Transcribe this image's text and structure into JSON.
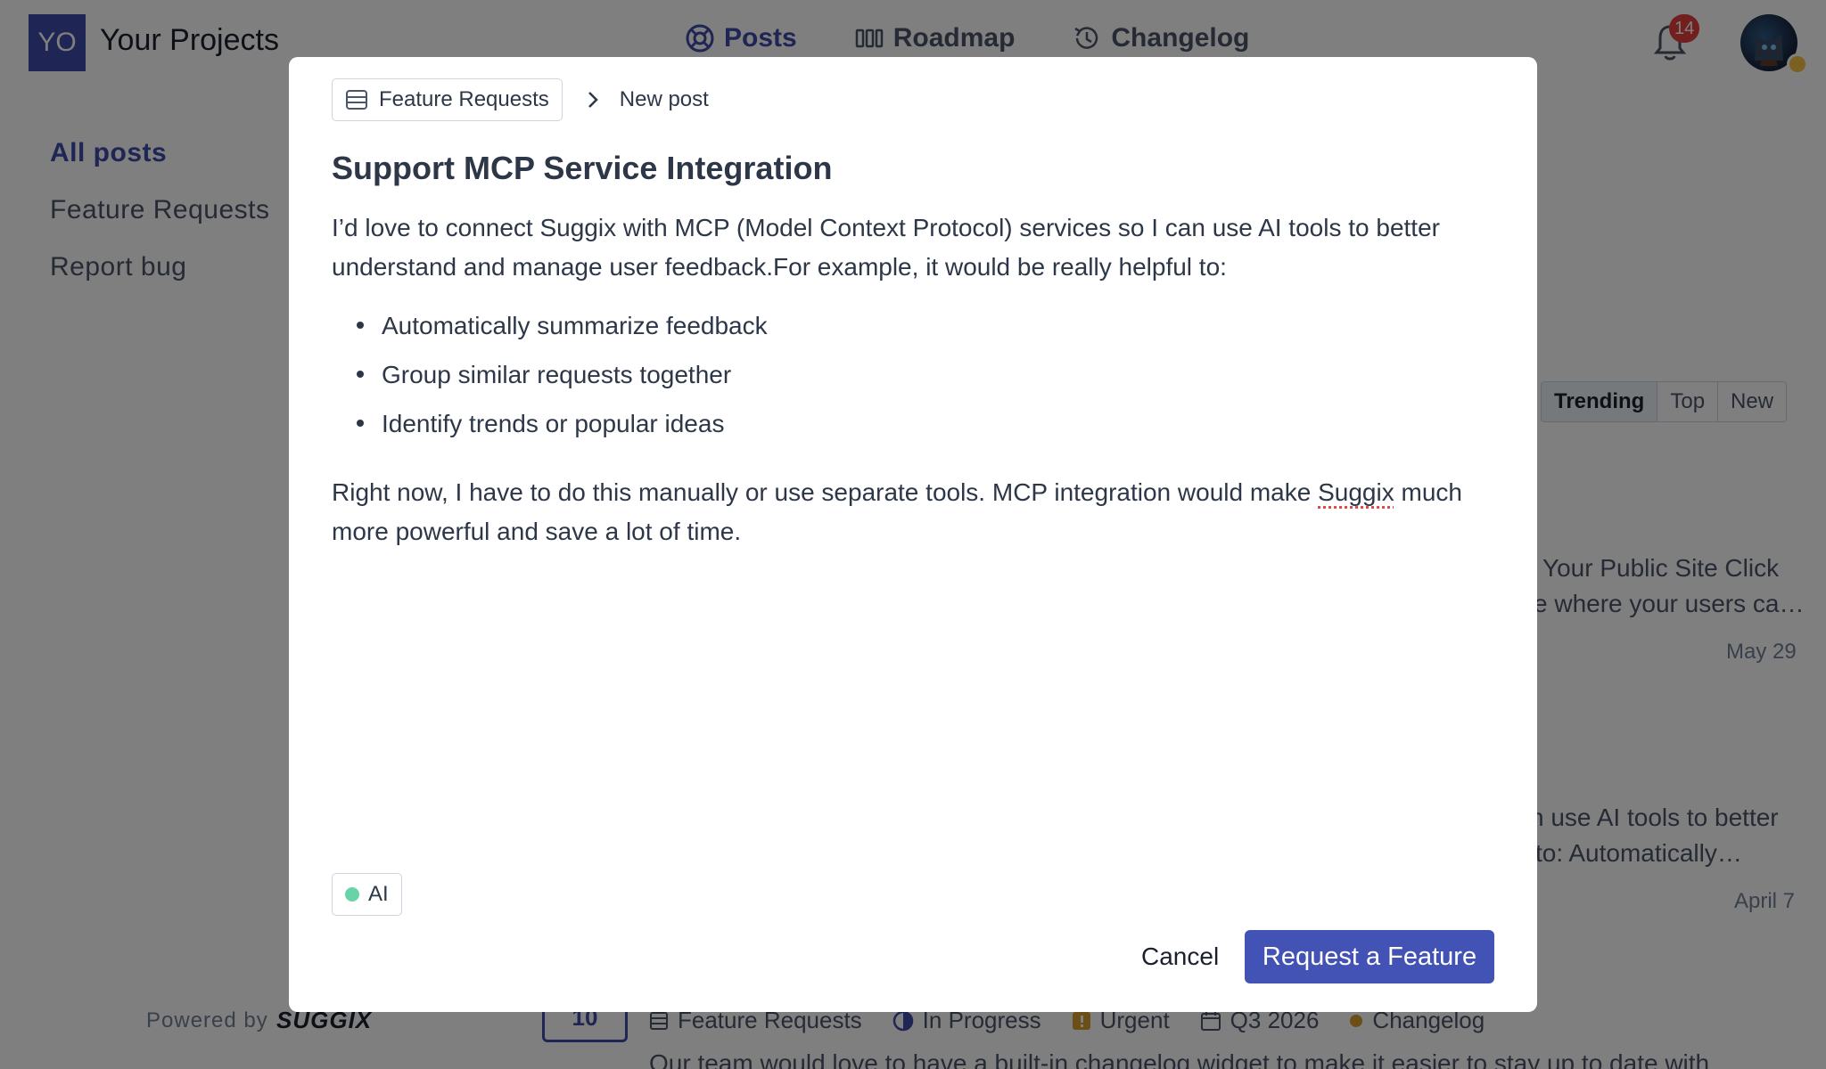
{
  "app": {
    "logo_initials": "YO",
    "project_name": "Your Projects",
    "nav": [
      {
        "label": "Posts",
        "icon": "lifebuoy-icon",
        "active": true
      },
      {
        "label": "Roadmap",
        "icon": "roadmap-columns-icon",
        "active": false
      },
      {
        "label": "Changelog",
        "icon": "history-icon",
        "active": false
      }
    ],
    "notifications_count": "14",
    "sidebar": [
      {
        "label": "All posts",
        "active": true
      },
      {
        "label": "Feature Requests",
        "active": false
      },
      {
        "label": "Report bug",
        "active": false
      }
    ],
    "sort_tabs": [
      {
        "label": "Trending",
        "active": true
      },
      {
        "label": "Top",
        "active": false
      },
      {
        "label": "New",
        "active": false
      }
    ],
    "posts_partial": [
      {
        "line1": "Your Public Site Click",
        "line2": "e where your users ca…",
        "date": "May 29"
      },
      {
        "line1": "n use AI tools to better",
        "line2": "to: Automatically…",
        "date": "April 7"
      }
    ],
    "footer": {
      "powered_by": "Powered by",
      "brand": "SUGGIX"
    },
    "bottom_post": {
      "votes": "10",
      "meta": [
        {
          "label": "Feature Requests",
          "icon": "board-icon"
        },
        {
          "label": "In Progress",
          "icon": "half-circle-icon"
        },
        {
          "label": "Urgent",
          "icon": "priority-icon"
        },
        {
          "label": "Q3 2026",
          "icon": "calendar-icon"
        },
        {
          "label": "Changelog",
          "icon": "dot-icon"
        }
      ],
      "description": "Our team would love to have a built-in changelog widget to make it easier to stay up to date with"
    },
    "colors": {
      "accent": "#3f4aa8",
      "button": "#4352b5",
      "badge": "#e53e3e",
      "tag_dot": "#68d3a6",
      "overlay": "rgba(0,0,0,0.5)"
    }
  },
  "modal": {
    "breadcrumb_board": "Feature Requests",
    "breadcrumb_current": "New post",
    "title": "Support MCP Service Integration",
    "intro_line1": "I’d love to connect Suggix with MCP (Model Context Protocol) services so I can use AI tools to better",
    "intro_line2": "understand and manage user feedback.For example, it would be really helpful to:",
    "bullets": [
      "Automatically summarize feedback",
      "Group similar requests together",
      "Identify trends or popular ideas"
    ],
    "closing_pre": "Right now, I have to do this manually or use separate tools. MCP integration would make ",
    "closing_spell": "Suggix",
    "closing_post": " much",
    "closing_line2": "more powerful and save a lot of time.",
    "tag": "AI",
    "cancel_label": "Cancel",
    "submit_label": "Request a Feature"
  }
}
